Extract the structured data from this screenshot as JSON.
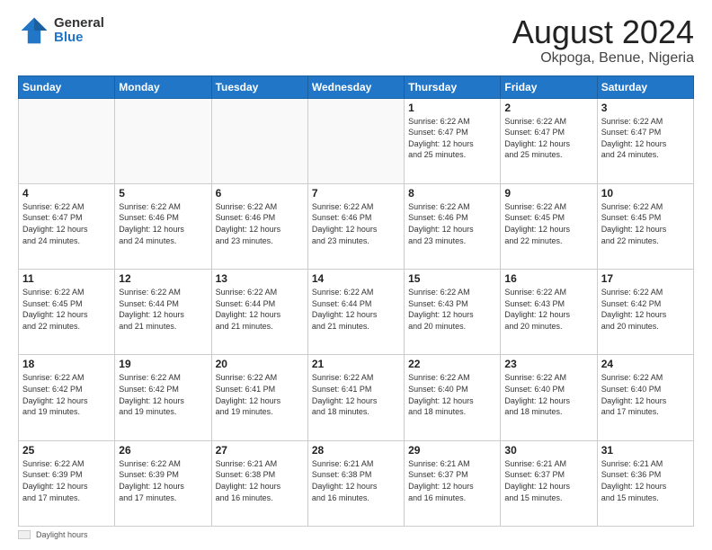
{
  "logo": {
    "general": "General",
    "blue": "Blue"
  },
  "header": {
    "title": "August 2024",
    "subtitle": "Okpoga, Benue, Nigeria"
  },
  "days_of_week": [
    "Sunday",
    "Monday",
    "Tuesday",
    "Wednesday",
    "Thursday",
    "Friday",
    "Saturday"
  ],
  "weeks": [
    [
      {
        "day": "",
        "info": ""
      },
      {
        "day": "",
        "info": ""
      },
      {
        "day": "",
        "info": ""
      },
      {
        "day": "",
        "info": ""
      },
      {
        "day": "1",
        "info": "Sunrise: 6:22 AM\nSunset: 6:47 PM\nDaylight: 12 hours\nand 25 minutes."
      },
      {
        "day": "2",
        "info": "Sunrise: 6:22 AM\nSunset: 6:47 PM\nDaylight: 12 hours\nand 25 minutes."
      },
      {
        "day": "3",
        "info": "Sunrise: 6:22 AM\nSunset: 6:47 PM\nDaylight: 12 hours\nand 24 minutes."
      }
    ],
    [
      {
        "day": "4",
        "info": "Sunrise: 6:22 AM\nSunset: 6:47 PM\nDaylight: 12 hours\nand 24 minutes."
      },
      {
        "day": "5",
        "info": "Sunrise: 6:22 AM\nSunset: 6:46 PM\nDaylight: 12 hours\nand 24 minutes."
      },
      {
        "day": "6",
        "info": "Sunrise: 6:22 AM\nSunset: 6:46 PM\nDaylight: 12 hours\nand 23 minutes."
      },
      {
        "day": "7",
        "info": "Sunrise: 6:22 AM\nSunset: 6:46 PM\nDaylight: 12 hours\nand 23 minutes."
      },
      {
        "day": "8",
        "info": "Sunrise: 6:22 AM\nSunset: 6:46 PM\nDaylight: 12 hours\nand 23 minutes."
      },
      {
        "day": "9",
        "info": "Sunrise: 6:22 AM\nSunset: 6:45 PM\nDaylight: 12 hours\nand 22 minutes."
      },
      {
        "day": "10",
        "info": "Sunrise: 6:22 AM\nSunset: 6:45 PM\nDaylight: 12 hours\nand 22 minutes."
      }
    ],
    [
      {
        "day": "11",
        "info": "Sunrise: 6:22 AM\nSunset: 6:45 PM\nDaylight: 12 hours\nand 22 minutes."
      },
      {
        "day": "12",
        "info": "Sunrise: 6:22 AM\nSunset: 6:44 PM\nDaylight: 12 hours\nand 21 minutes."
      },
      {
        "day": "13",
        "info": "Sunrise: 6:22 AM\nSunset: 6:44 PM\nDaylight: 12 hours\nand 21 minutes."
      },
      {
        "day": "14",
        "info": "Sunrise: 6:22 AM\nSunset: 6:44 PM\nDaylight: 12 hours\nand 21 minutes."
      },
      {
        "day": "15",
        "info": "Sunrise: 6:22 AM\nSunset: 6:43 PM\nDaylight: 12 hours\nand 20 minutes."
      },
      {
        "day": "16",
        "info": "Sunrise: 6:22 AM\nSunset: 6:43 PM\nDaylight: 12 hours\nand 20 minutes."
      },
      {
        "day": "17",
        "info": "Sunrise: 6:22 AM\nSunset: 6:42 PM\nDaylight: 12 hours\nand 20 minutes."
      }
    ],
    [
      {
        "day": "18",
        "info": "Sunrise: 6:22 AM\nSunset: 6:42 PM\nDaylight: 12 hours\nand 19 minutes."
      },
      {
        "day": "19",
        "info": "Sunrise: 6:22 AM\nSunset: 6:42 PM\nDaylight: 12 hours\nand 19 minutes."
      },
      {
        "day": "20",
        "info": "Sunrise: 6:22 AM\nSunset: 6:41 PM\nDaylight: 12 hours\nand 19 minutes."
      },
      {
        "day": "21",
        "info": "Sunrise: 6:22 AM\nSunset: 6:41 PM\nDaylight: 12 hours\nand 18 minutes."
      },
      {
        "day": "22",
        "info": "Sunrise: 6:22 AM\nSunset: 6:40 PM\nDaylight: 12 hours\nand 18 minutes."
      },
      {
        "day": "23",
        "info": "Sunrise: 6:22 AM\nSunset: 6:40 PM\nDaylight: 12 hours\nand 18 minutes."
      },
      {
        "day": "24",
        "info": "Sunrise: 6:22 AM\nSunset: 6:40 PM\nDaylight: 12 hours\nand 17 minutes."
      }
    ],
    [
      {
        "day": "25",
        "info": "Sunrise: 6:22 AM\nSunset: 6:39 PM\nDaylight: 12 hours\nand 17 minutes."
      },
      {
        "day": "26",
        "info": "Sunrise: 6:22 AM\nSunset: 6:39 PM\nDaylight: 12 hours\nand 17 minutes."
      },
      {
        "day": "27",
        "info": "Sunrise: 6:21 AM\nSunset: 6:38 PM\nDaylight: 12 hours\nand 16 minutes."
      },
      {
        "day": "28",
        "info": "Sunrise: 6:21 AM\nSunset: 6:38 PM\nDaylight: 12 hours\nand 16 minutes."
      },
      {
        "day": "29",
        "info": "Sunrise: 6:21 AM\nSunset: 6:37 PM\nDaylight: 12 hours\nand 16 minutes."
      },
      {
        "day": "30",
        "info": "Sunrise: 6:21 AM\nSunset: 6:37 PM\nDaylight: 12 hours\nand 15 minutes."
      },
      {
        "day": "31",
        "info": "Sunrise: 6:21 AM\nSunset: 6:36 PM\nDaylight: 12 hours\nand 15 minutes."
      }
    ]
  ],
  "footer": {
    "daylight_label": "Daylight hours"
  }
}
